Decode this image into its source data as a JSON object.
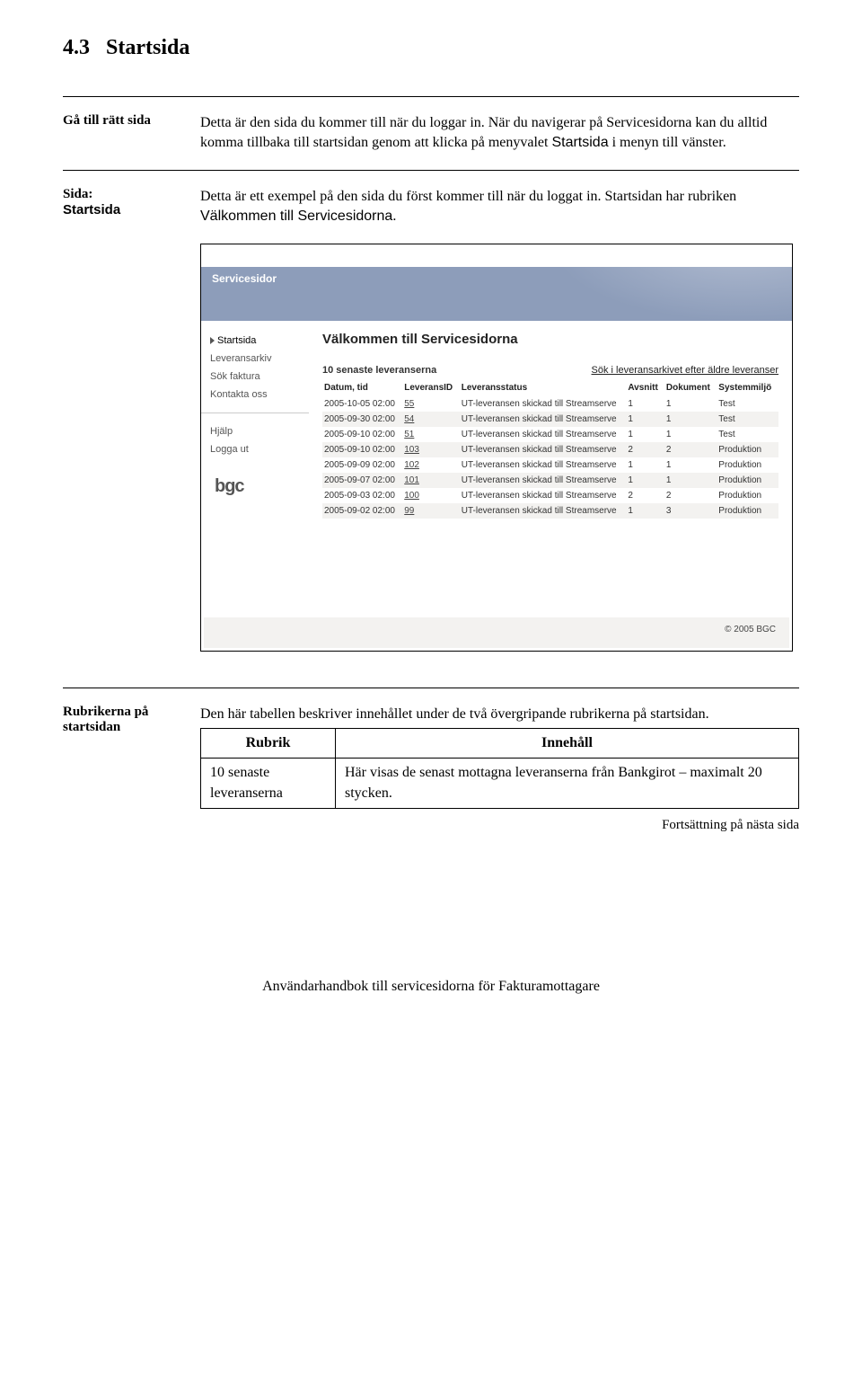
{
  "section": {
    "number": "4.3",
    "title": "Startsida"
  },
  "block1": {
    "label": "Gå till rätt sida",
    "p1": "Detta är den sida du kommer till när du loggar in. När du navigerar på Servicesidorna kan du alltid komma tillbaka till startsidan genom att klicka på menyvalet ",
    "p1_term": "Startsida",
    "p1_after": " i menyn till vänster."
  },
  "block2": {
    "label_l1": "Sida:",
    "label_l2": "Startsida",
    "p1": "Detta är ett exempel på den sida du först kommer till när du loggat in. Startsidan har rubriken ",
    "p1_term": "Välkommen till Servicesidorna",
    "p1_after": "."
  },
  "screenshot": {
    "banner_title": "Servicesidor",
    "nav_group1": [
      "Startsida",
      "Leveransarkiv",
      "Sök faktura",
      "Kontakta oss"
    ],
    "nav_group2": [
      "Hjälp",
      "Logga ut"
    ],
    "main_heading": "Välkommen till Servicesidorna",
    "subtitle": "10 senaste leveranserna",
    "search_link": "Sök i leveransarkivet efter äldre leveranser",
    "columns": [
      "Datum, tid",
      "LeveransID",
      "Leveransstatus",
      "Avsnitt",
      "Dokument",
      "Systemmiljö"
    ],
    "rows": [
      {
        "datum": "2005-10-05 02:00",
        "id": "55",
        "status": "UT-leveransen skickad till Streamserve",
        "avsnitt": "1",
        "dokument": "1",
        "miljo": "Test"
      },
      {
        "datum": "2005-09-30 02:00",
        "id": "54",
        "status": "UT-leveransen skickad till Streamserve",
        "avsnitt": "1",
        "dokument": "1",
        "miljo": "Test"
      },
      {
        "datum": "2005-09-10 02:00",
        "id": "51",
        "status": "UT-leveransen skickad till Streamserve",
        "avsnitt": "1",
        "dokument": "1",
        "miljo": "Test"
      },
      {
        "datum": "2005-09-10 02:00",
        "id": "103",
        "status": "UT-leveransen skickad till Streamserve",
        "avsnitt": "2",
        "dokument": "2",
        "miljo": "Produktion"
      },
      {
        "datum": "2005-09-09 02:00",
        "id": "102",
        "status": "UT-leveransen skickad till Streamserve",
        "avsnitt": "1",
        "dokument": "1",
        "miljo": "Produktion"
      },
      {
        "datum": "2005-09-07 02:00",
        "id": "101",
        "status": "UT-leveransen skickad till Streamserve",
        "avsnitt": "1",
        "dokument": "1",
        "miljo": "Produktion"
      },
      {
        "datum": "2005-09-03 02:00",
        "id": "100",
        "status": "UT-leveransen skickad till Streamserve",
        "avsnitt": "2",
        "dokument": "2",
        "miljo": "Produktion"
      },
      {
        "datum": "2005-09-02 02:00",
        "id": "99",
        "status": "UT-leveransen skickad till Streamserve",
        "avsnitt": "1",
        "dokument": "3",
        "miljo": "Produktion"
      }
    ],
    "bgc_logo": "bgc",
    "copyright": "© 2005 BGC"
  },
  "block3": {
    "label_l1": "Rubrikerna på",
    "label_l2": "startsidan",
    "p1": "Den här tabellen beskriver innehållet under de två övergripande rubrikerna på startsidan."
  },
  "rubrik_table": {
    "hdr_l": "Rubrik",
    "hdr_r": "Innehåll",
    "row1_l1": "10 senaste",
    "row1_l2": "leveranserna",
    "row1_r": "Här visas de senast mottagna leveranserna från Bankgirot – maximalt 20 stycken."
  },
  "continue_text": "Fortsättning på nästa sida",
  "footer_text": "Användarhandbok till servicesidorna för Fakturamottagare"
}
